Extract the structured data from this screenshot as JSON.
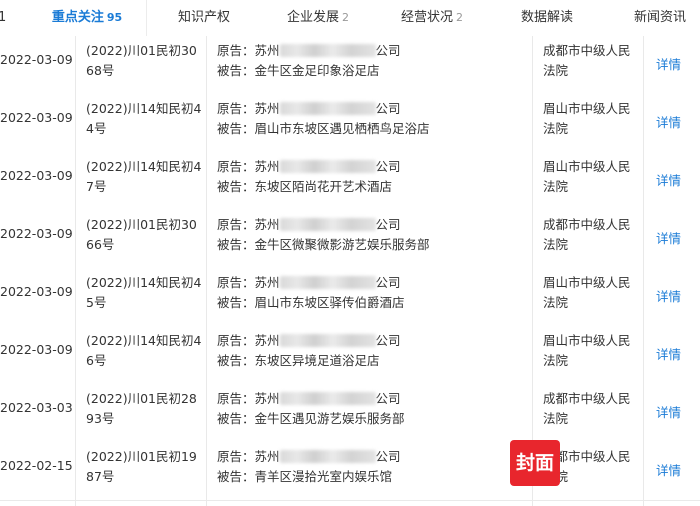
{
  "tabs": [
    {
      "label": "1",
      "count": ""
    },
    {
      "label": "重点关注",
      "count": "95"
    },
    {
      "label": "知识产权",
      "count": ""
    },
    {
      "label": "企业发展",
      "count": "2"
    },
    {
      "label": "经营状况",
      "count": "2"
    },
    {
      "label": "数据解读",
      "count": ""
    },
    {
      "label": "新闻资讯",
      "count": ""
    }
  ],
  "active_tab": "重点关注",
  "rows": [
    {
      "date": "2022-03-09",
      "case_no": "(2022)川01民初3068号",
      "plaintiff_prefix": "原告：苏州",
      "plaintiff_suffix": "公司",
      "defendant": "被告：金牛区金足印象浴足店",
      "court": "成都市中级人民法院",
      "action": "详情"
    },
    {
      "date": "2022-03-09",
      "case_no": "(2022)川14知民初44号",
      "plaintiff_prefix": "原告：苏州",
      "plaintiff_suffix": "公司",
      "defendant": "被告：眉山市东坡区遇见栖栖鸟足浴店",
      "court": "眉山市中级人民法院",
      "action": "详情"
    },
    {
      "date": "2022-03-09",
      "case_no": "(2022)川14知民初47号",
      "plaintiff_prefix": "原告：苏州",
      "plaintiff_suffix": "公司",
      "defendant": "被告：东坡区陌尚花开艺术酒店",
      "court": "眉山市中级人民法院",
      "action": "详情"
    },
    {
      "date": "2022-03-09",
      "case_no": "(2022)川01民初3066号",
      "plaintiff_prefix": "原告：苏州",
      "plaintiff_suffix": "公司",
      "defendant": "被告：金牛区微聚微影游艺娱乐服务部",
      "court": "成都市中级人民法院",
      "action": "详情"
    },
    {
      "date": "2022-03-09",
      "case_no": "(2022)川14知民初45号",
      "plaintiff_prefix": "原告：苏州",
      "plaintiff_suffix": "公司",
      "defendant": "被告：眉山市东坡区驿传伯爵酒店",
      "court": "眉山市中级人民法院",
      "action": "详情"
    },
    {
      "date": "2022-03-09",
      "case_no": "(2022)川14知民初46号",
      "plaintiff_prefix": "原告：苏州",
      "plaintiff_suffix": "公司",
      "defendant": "被告：东坡区异境足道浴足店",
      "court": "眉山市中级人民法院",
      "action": "详情"
    },
    {
      "date": "2022-03-03",
      "case_no": "(2022)川01民初2893号",
      "plaintiff_prefix": "原告：苏州",
      "plaintiff_suffix": "公司",
      "defendant": "被告：金牛区遇见游艺娱乐服务部",
      "court": "成都市中级人民法院",
      "action": "详情"
    },
    {
      "date": "2022-02-15",
      "case_no": "(2022)川01民初1987号",
      "plaintiff_prefix": "原告：苏州",
      "plaintiff_suffix": "公司",
      "defendant": "被告：青羊区漫拾光室内娱乐馆",
      "court": "成都市中级人民法院",
      "action": "详情"
    }
  ],
  "watermark": {
    "text": "封面",
    "color": "#e8262d"
  },
  "colors": {
    "accent": "#1a7bd6",
    "border": "#e9e9e9"
  }
}
